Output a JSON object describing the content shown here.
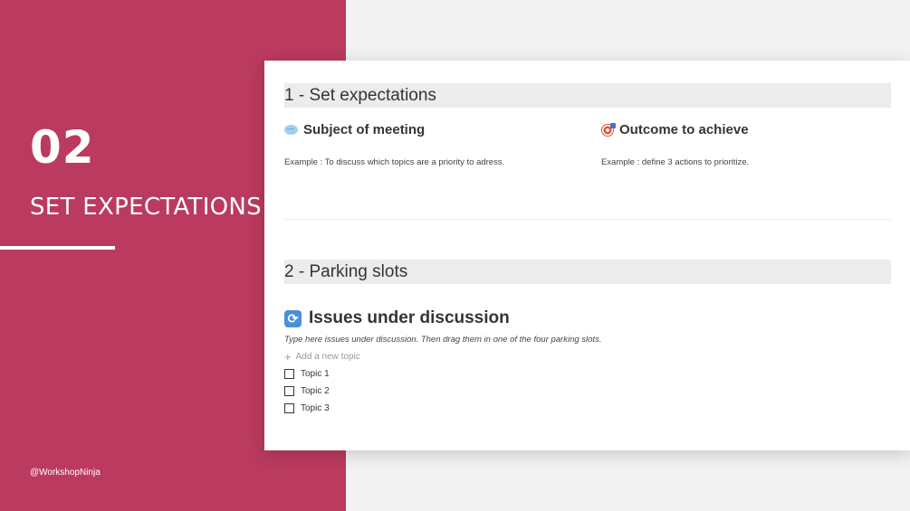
{
  "slide": {
    "number": "02",
    "title": "SET EXPECTATIONS",
    "handle": "@WorkshopNinja",
    "colors": {
      "panel": "#bb3a5f",
      "background": "#f2f2f2"
    }
  },
  "document": {
    "section1": {
      "header": "1 - Set expectations",
      "subject": {
        "icon": "speech-bubble-icon",
        "title": "Subject of meeting",
        "example": "Example : To discuss which topics are a priority to adress."
      },
      "outcome": {
        "icon": "target-icon",
        "title": "Outcome to achieve",
        "example": "Example : define 3 actions to prioritize."
      }
    },
    "section2": {
      "header": "2 - Parking slots",
      "issues": {
        "icon": "refresh-icon",
        "title": "Issues under discussion",
        "instructions": "Type here issues under discussion. Then drag them in one of the four parking slots.",
        "add_label": "Add a new topic",
        "topics": [
          "Topic 1",
          "Topic 2",
          "Topic 3"
        ]
      }
    }
  }
}
